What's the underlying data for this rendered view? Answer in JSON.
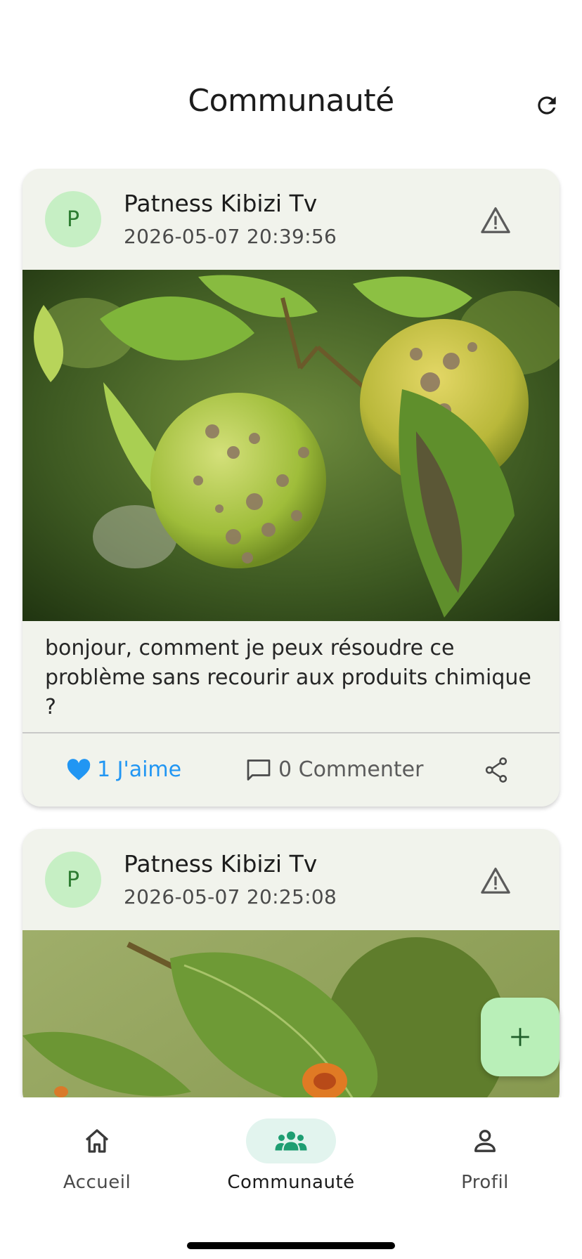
{
  "header": {
    "title": "Communauté",
    "refresh_icon": "refresh-icon"
  },
  "posts": [
    {
      "author_initial": "P",
      "author": "Patness Kibizi Tv",
      "timestamp": "2026-05-07 20:39:56",
      "image": "apple-scab-photo",
      "text": "bonjour, comment je peux résoudre ce problème sans recourir aux produits chimique ?",
      "like_label": "1 J'aime",
      "comment_label": "0 Commenter"
    },
    {
      "author_initial": "P",
      "author": "Patness Kibizi Tv",
      "timestamp": "2026-05-07 20:25:08",
      "image": "pear-rust-leaf-photo"
    }
  ],
  "fab": {
    "icon": "plus-icon"
  },
  "nav": {
    "items": [
      {
        "label": "Accueil",
        "icon": "home-icon"
      },
      {
        "label": "Communauté",
        "icon": "community-icon",
        "active": true
      },
      {
        "label": "Profil",
        "icon": "person-icon"
      }
    ]
  },
  "colors": {
    "accent": "#2196f3",
    "card_bg": "#f1f3ec",
    "avatar_bg": "#c6efc4",
    "fab_bg": "#b9efb8",
    "nav_active_bg": "#e2f4ee"
  }
}
